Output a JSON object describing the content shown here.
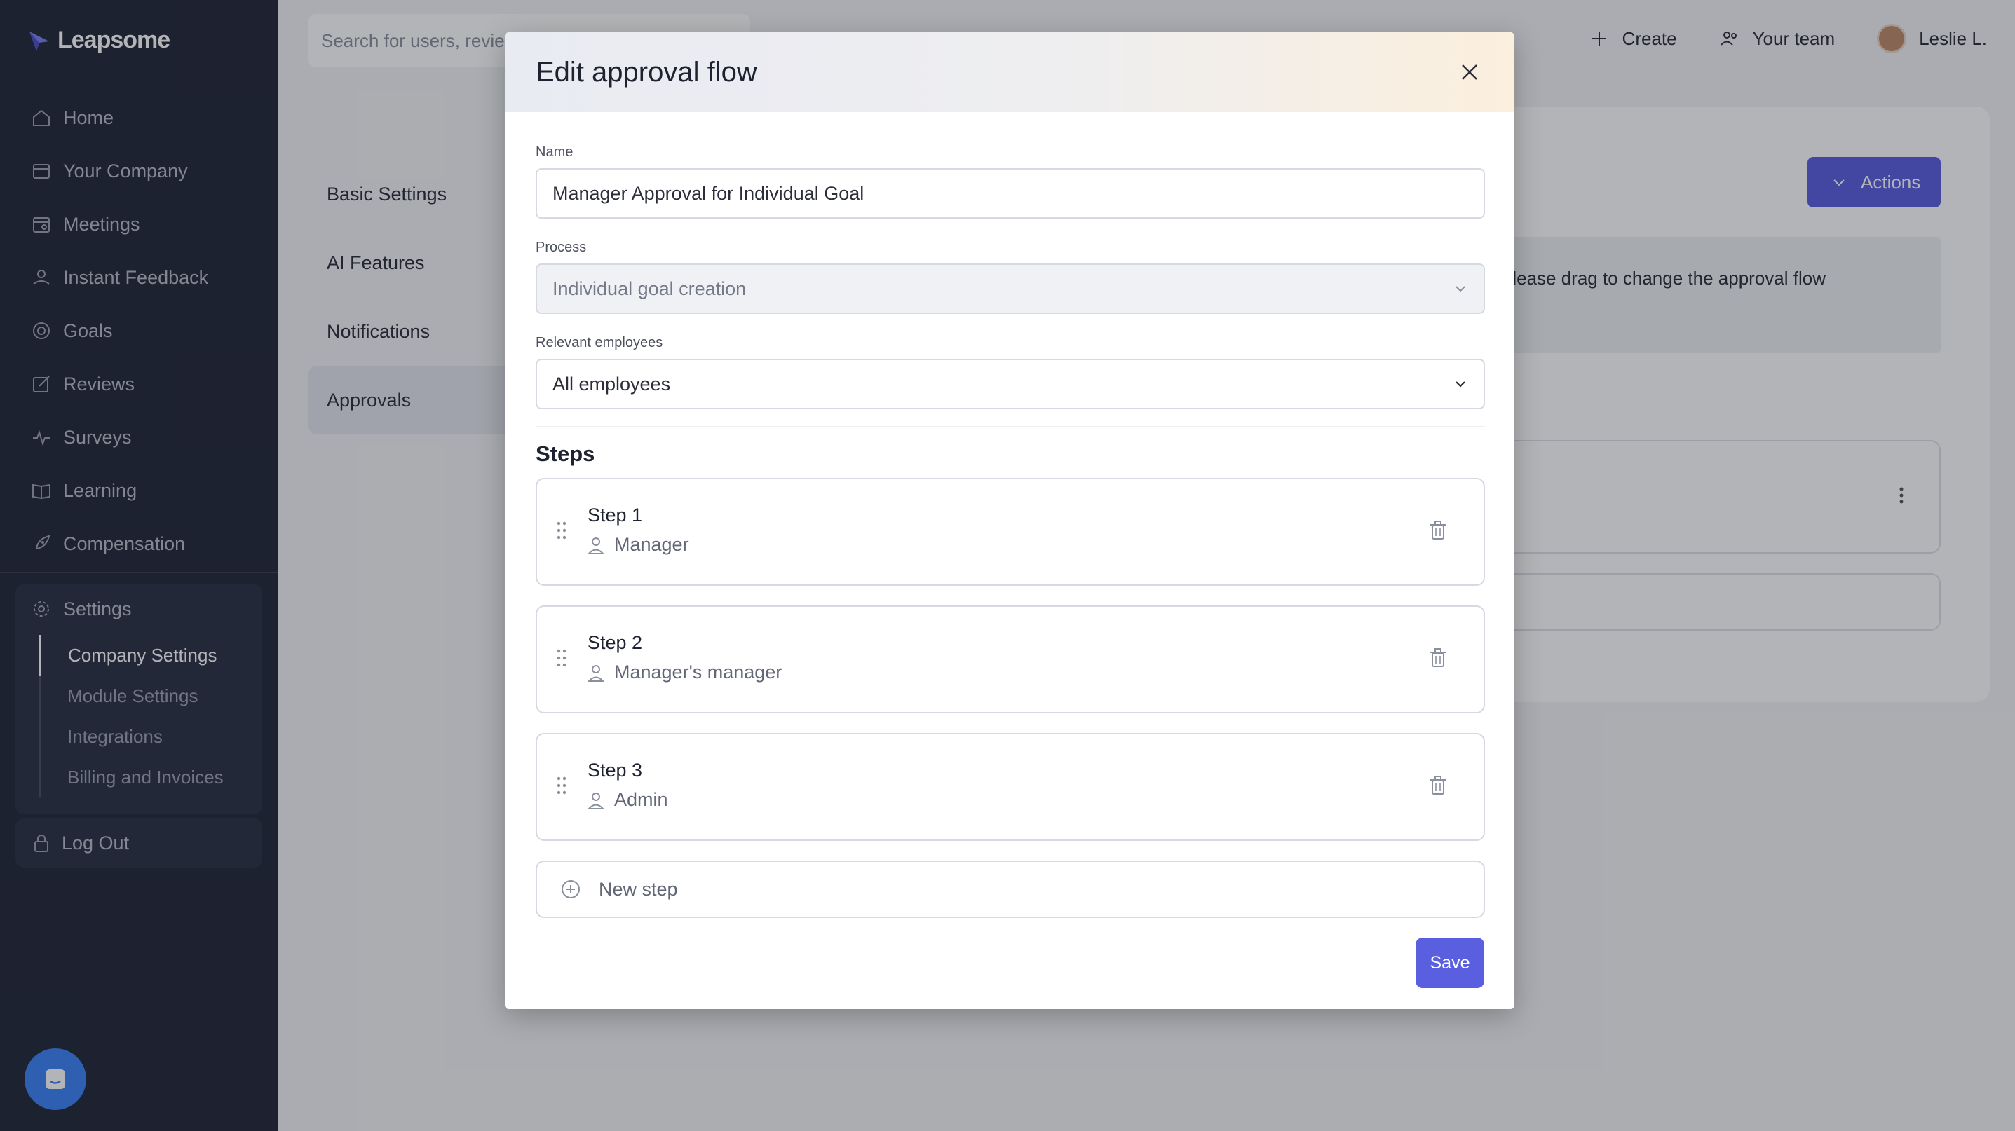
{
  "app": {
    "brand": "Leapsome",
    "search_placeholder": "Search for users, revie"
  },
  "sidebar": {
    "items": [
      {
        "label": "Home",
        "icon": "home-icon"
      },
      {
        "label": "Your Company",
        "icon": "building-icon"
      },
      {
        "label": "Meetings",
        "icon": "calendar-icon"
      },
      {
        "label": "Instant Feedback",
        "icon": "feedback-icon"
      },
      {
        "label": "Goals",
        "icon": "target-icon"
      },
      {
        "label": "Reviews",
        "icon": "edit-icon"
      },
      {
        "label": "Surveys",
        "icon": "pulse-icon"
      },
      {
        "label": "Learning",
        "icon": "book-icon"
      },
      {
        "label": "Compensation",
        "icon": "rocket-icon"
      }
    ],
    "settings_label": "Settings",
    "settings_sub": [
      "Company Settings",
      "Module Settings",
      "Integrations",
      "Billing and Invoices"
    ],
    "logout_label": "Log Out"
  },
  "topbar": {
    "create_label": "Create",
    "team_label": "Your team",
    "user_name": "Leslie L."
  },
  "settings_tabs": [
    "Basic Settings",
    "AI Features",
    "Notifications",
    "Approvals"
  ],
  "background": {
    "actions_label": "Actions",
    "info_text": "Please drag to change the approval flow"
  },
  "modal": {
    "title": "Edit approval flow",
    "name_label": "Name",
    "name_value": "Manager Approval for Individual Goal",
    "process_label": "Process",
    "process_value": "Individual goal creation",
    "employees_label": "Relevant employees",
    "employees_value": "All employees",
    "steps_title": "Steps",
    "steps": [
      {
        "name": "Step 1",
        "role": "Manager"
      },
      {
        "name": "Step 2",
        "role": "Manager's manager"
      },
      {
        "name": "Step 3",
        "role": "Admin"
      }
    ],
    "new_step_label": "New step",
    "save_label": "Save"
  },
  "colors": {
    "sidebar_bg": "#232838",
    "accent": "#5a5fe0",
    "chat_button": "#3b82f6"
  }
}
